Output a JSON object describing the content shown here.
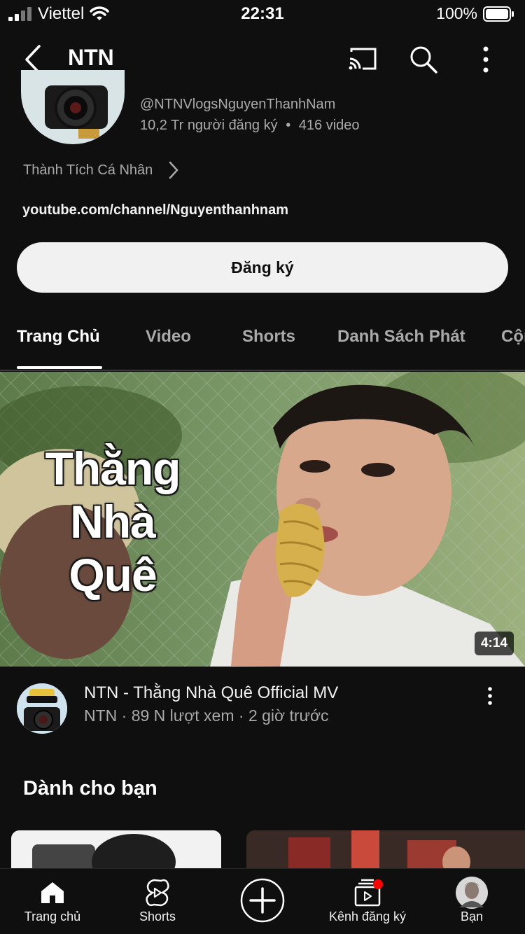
{
  "status_bar": {
    "carrier": "Viettel",
    "time": "22:31",
    "battery": "100%"
  },
  "header": {
    "title": "NTN"
  },
  "channel": {
    "handle": "@NTNVlogsNguyenThanhNam",
    "subscribers": "10,2 Tr người đăng ký",
    "separator": "•",
    "videos": "416 video",
    "achievement": "Thành Tích Cá Nhân",
    "link": "youtube.com/channel/Nguyenthanhnam",
    "subscribe_label": "Đăng ký"
  },
  "tabs": [
    {
      "label": "Trang Chủ",
      "active": true
    },
    {
      "label": "Video",
      "active": false
    },
    {
      "label": "Shorts",
      "active": false
    },
    {
      "label": "Danh Sách Phát",
      "active": false
    },
    {
      "label": "Cộng",
      "active": false
    }
  ],
  "featured_video": {
    "thumbnail_text": [
      "Thằng",
      "Nhà",
      "Quê"
    ],
    "duration": "4:14",
    "title": "NTN - Thằng Nhà Quê Official MV",
    "meta": "NTN · 89 N lượt xem · 2 giờ trước"
  },
  "section": {
    "title": "Dành cho bạn"
  },
  "bottom_nav": [
    {
      "label": "Trang chủ",
      "icon": "home-icon"
    },
    {
      "label": "Shorts",
      "icon": "shorts-icon"
    },
    {
      "label": "",
      "icon": "create-icon"
    },
    {
      "label": "Kênh đăng ký",
      "icon": "subscriptions-icon"
    },
    {
      "label": "Bạn",
      "icon": "profile-avatar"
    }
  ],
  "colors": {
    "background": "#0f0f0f",
    "text_primary": "#f1f1f1",
    "text_secondary": "#aaaaaa",
    "notification_dot": "#ff0000"
  }
}
